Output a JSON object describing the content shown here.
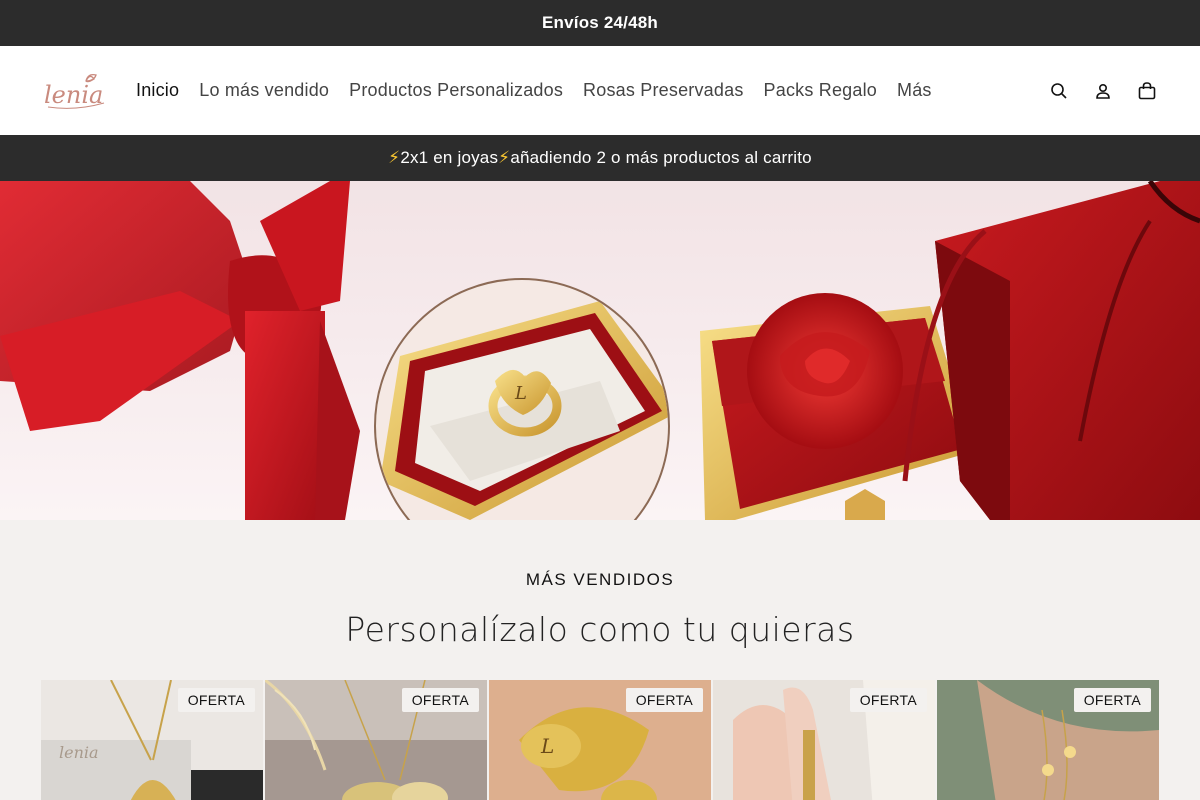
{
  "announcement": {
    "text": "Envíos 24/48h"
  },
  "header": {
    "logo_text": "lenia",
    "nav": [
      {
        "label": "Inicio",
        "active": true
      },
      {
        "label": "Lo más vendido"
      },
      {
        "label": "Productos Personalizados"
      },
      {
        "label": "Rosas Preservadas"
      },
      {
        "label": "Packs Regalo"
      },
      {
        "label": "Más"
      }
    ],
    "icons": [
      "search-icon",
      "account-icon",
      "cart-icon"
    ]
  },
  "promo": {
    "bolt": "⚡",
    "part1": " 2x1 en joyas ",
    "part2": " añadiendo 2 o más productos al carrito"
  },
  "section": {
    "kicker": "MÁS VENDIDOS",
    "title": "Personalízalo como tu quieras"
  },
  "products": [
    {
      "badge": "OFERTA"
    },
    {
      "badge": "OFERTA"
    },
    {
      "badge": "OFERTA"
    },
    {
      "badge": "OFERTA"
    },
    {
      "badge": "OFERTA"
    }
  ],
  "colors": {
    "dark_bar": "#2c2c2c",
    "accent_red": "#c8141c",
    "logo": "#c98a7e",
    "background": "#f3f1ef"
  }
}
